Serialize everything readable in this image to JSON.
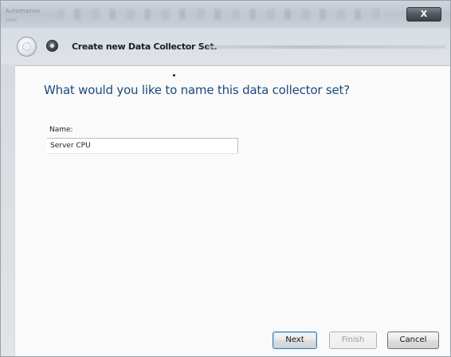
{
  "window": {
    "titlebar_text": "Automation",
    "close_label": "X"
  },
  "header": {
    "title": "Create new Data Collector Set."
  },
  "main": {
    "question": "What would you like to name this data collector set?",
    "name_label": "Name:",
    "name_value": "Server CPU"
  },
  "buttons": {
    "next": "Next",
    "finish": "Finish",
    "cancel": "Cancel"
  },
  "icons": {
    "back": "back-arrow-icon",
    "app": "performance-monitor-icon"
  },
  "colors": {
    "question_text": "#1c4a7e",
    "close_button": "#4f545b"
  }
}
